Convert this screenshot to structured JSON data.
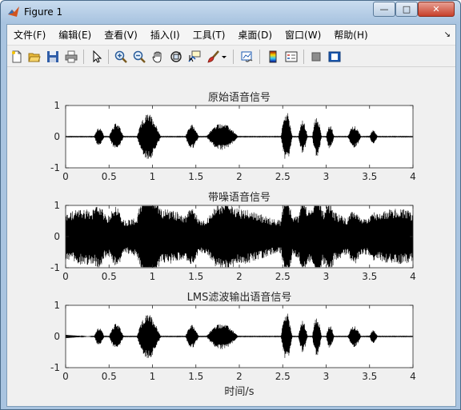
{
  "window": {
    "title": "Figure 1",
    "minimize_glyph": "—",
    "maximize_glyph": "□",
    "close_glyph": "✕"
  },
  "menu": {
    "items": [
      {
        "label": "文件(F)"
      },
      {
        "label": "编辑(E)"
      },
      {
        "label": "查看(V)"
      },
      {
        "label": "插入(I)"
      },
      {
        "label": "工具(T)"
      },
      {
        "label": "桌面(D)"
      },
      {
        "label": "窗口(W)"
      },
      {
        "label": "帮助(H)"
      }
    ],
    "dock_arrow": "↘"
  },
  "toolbar": {
    "icons": [
      "new-figure-icon",
      "open-file-icon",
      "save-icon",
      "print-icon",
      "pointer-icon",
      "zoom-in-icon",
      "zoom-out-icon",
      "pan-icon",
      "rotate-3d-icon",
      "data-cursor-icon",
      "brush-icon",
      "brush-dropdown-icon",
      "link-plot-icon",
      "colorbar-icon",
      "legend-icon",
      "hide-plot-tools-icon",
      "show-plot-tools-icon"
    ]
  },
  "chart_data": [
    {
      "type": "line",
      "title": "原始语音信号",
      "xlabel": "",
      "ylabel": "",
      "xlim": [
        0,
        4
      ],
      "ylim": [
        -1,
        1
      ],
      "xticks": [
        "0",
        "0.5",
        "1",
        "1.5",
        "2",
        "2.5",
        "3",
        "3.5",
        "4"
      ],
      "yticks": [
        "1",
        "0",
        "-1"
      ],
      "color": "#000000"
    },
    {
      "type": "line",
      "title": "带噪语音信号",
      "xlabel": "",
      "ylabel": "",
      "xlim": [
        0,
        4
      ],
      "ylim": [
        -1,
        1
      ],
      "xticks": [
        "0",
        "0.5",
        "1",
        "1.5",
        "2",
        "2.5",
        "3",
        "3.5",
        "4"
      ],
      "yticks": [
        "1",
        "0",
        "-1"
      ],
      "color": "#000000"
    },
    {
      "type": "line",
      "title": "LMS滤波输出语音信号",
      "xlabel": "时间/s",
      "ylabel": "",
      "xlim": [
        0,
        4
      ],
      "ylim": [
        -1,
        1
      ],
      "xticks": [
        "0",
        "0.5",
        "1",
        "1.5",
        "2",
        "2.5",
        "3",
        "3.5",
        "4"
      ],
      "yticks": [
        "1",
        "0",
        "-1"
      ],
      "color": "#000000"
    }
  ]
}
